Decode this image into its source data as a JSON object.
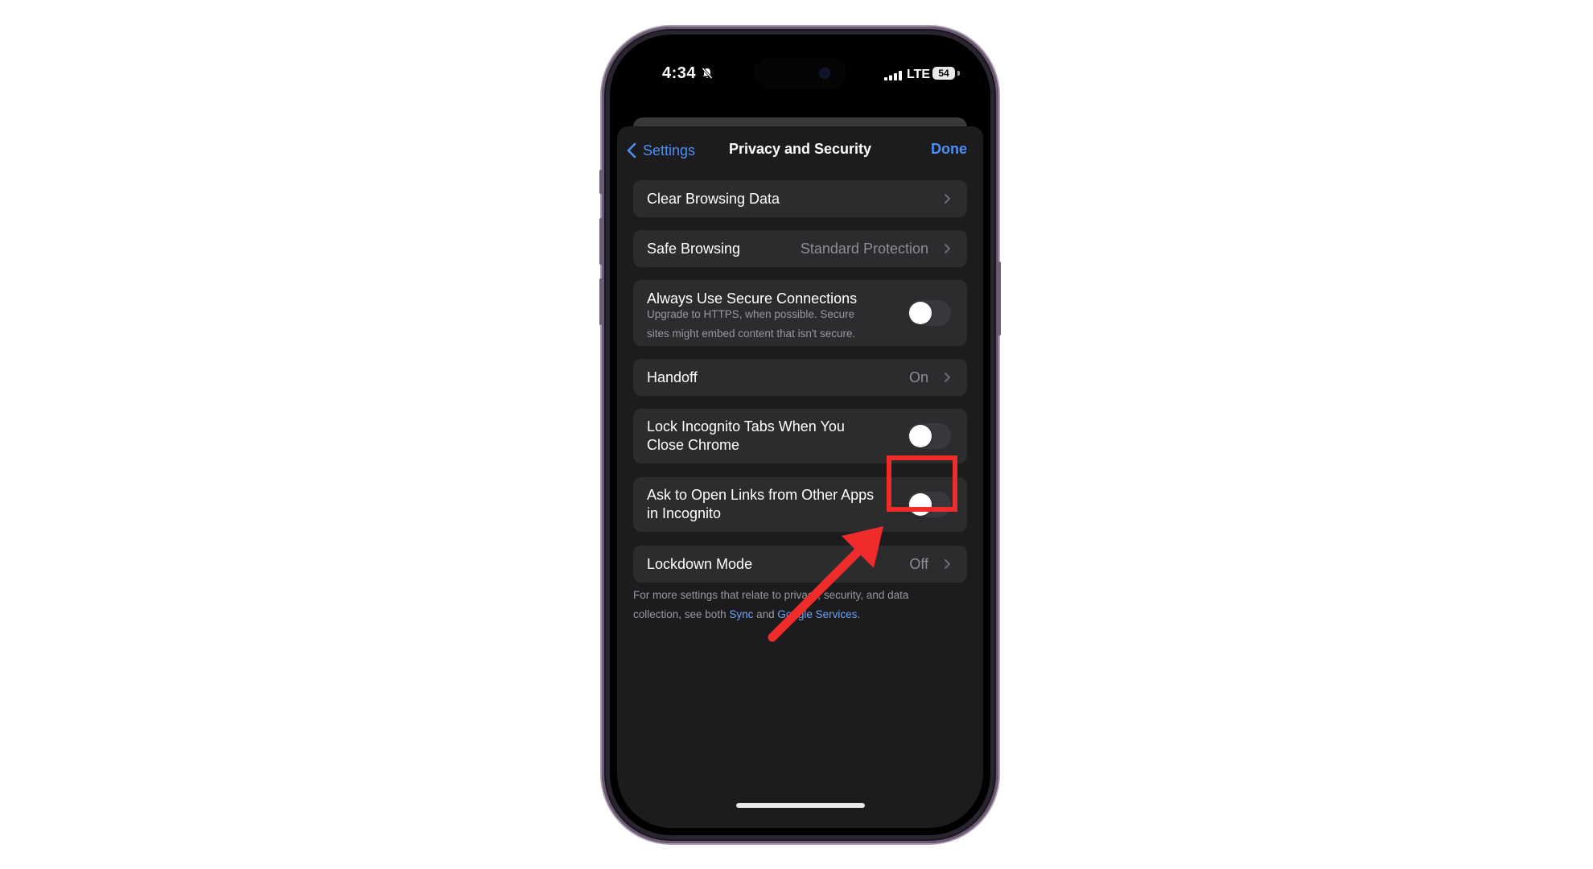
{
  "status_bar": {
    "time": "4:34",
    "network": "LTE",
    "battery": "54"
  },
  "nav": {
    "back_label": "Settings",
    "title": "Privacy and Security",
    "done_label": "Done"
  },
  "rows": {
    "clear_browsing": {
      "label": "Clear Browsing Data"
    },
    "safe_browsing": {
      "label": "Safe Browsing",
      "value": "Standard Protection"
    },
    "secure_connections": {
      "label": "Always Use Secure Connections",
      "subtitle_line1": "Upgrade to HTTPS, when possible. Secure",
      "subtitle_line2": "sites might embed content that isn't secure.",
      "enabled": false
    },
    "handoff": {
      "label": "Handoff",
      "value": "On"
    },
    "lock_incognito": {
      "label_line1": "Lock Incognito Tabs When You",
      "label_line2": "Close Chrome",
      "enabled": false
    },
    "ask_open_links": {
      "label_line1": "Ask to Open Links from Other Apps",
      "label_line2": "in Incognito",
      "enabled": false
    },
    "lockdown_mode": {
      "label": "Lockdown Mode",
      "value": "Off"
    }
  },
  "footer": {
    "line1": "For more settings that relate to privacy, security, and data",
    "line2_prefix": "collection, see both ",
    "sync_link": "Sync",
    "and_text": " and ",
    "google_services_link": "Google Services",
    "suffix": "."
  },
  "colors": {
    "accent": "#4c8ff5",
    "annotation": "#ef2b2b",
    "cell_background": "#2c2c2e",
    "sheet_background": "#1c1c1e"
  }
}
